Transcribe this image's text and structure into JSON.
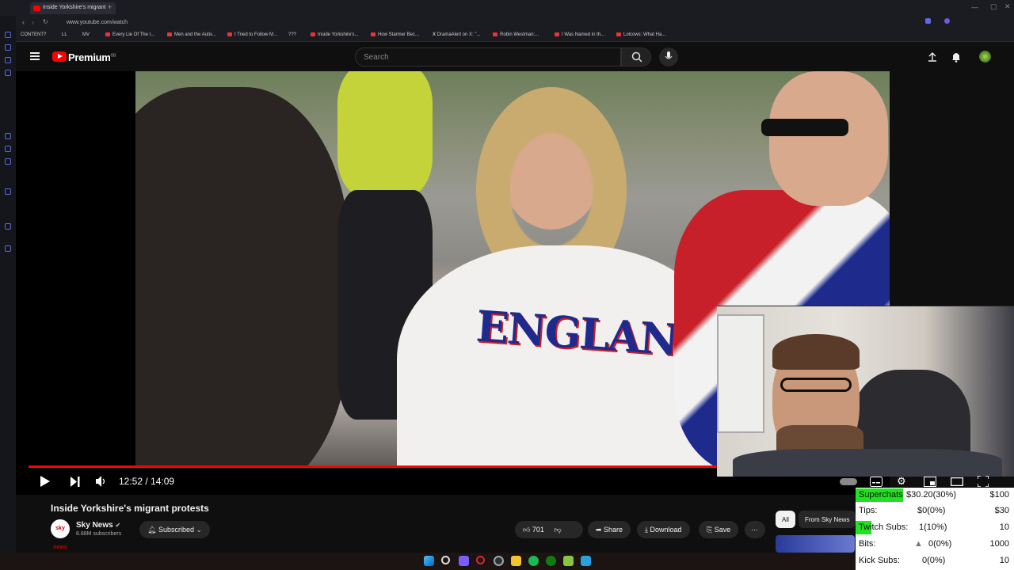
{
  "browser": {
    "tab_title": "Inside Yorkshire's migrant",
    "url": "www.youtube.com/watch",
    "bookmarks": [
      "CONTENT?",
      "LL",
      "MV",
      "Every Lie Of The I...",
      "Men and the Autis...",
      "I Tried to Follow M...",
      "???",
      "Inside Yorkshire's...",
      "How Starmer Bec...",
      "DramaAlert on X: \"...",
      "Robin Westman:...",
      "I Was Named in th...",
      "Lolcows: What Ha..."
    ]
  },
  "header": {
    "brand": "Premium",
    "region": "GB",
    "search_placeholder": "Search"
  },
  "player": {
    "current_time": "12:52",
    "duration": "14:09",
    "time_text": "12:52 / 14:09",
    "progress_fraction": 0.909,
    "overlay_text": "ENGLAND"
  },
  "video": {
    "title": "Inside Yorkshire's migrant protests",
    "channel": "Sky News",
    "channel_avatar_text": "sky news",
    "subscribers": "8.88M subscribers",
    "subscribe_label": "Subscribed",
    "likes": "701",
    "share_label": "Share",
    "download_label": "Download",
    "save_label": "Save"
  },
  "chips": [
    "All",
    "From Sky News"
  ],
  "donation_stats": [
    {
      "label": "Superchats",
      "value": "$30.20(30%)",
      "goal": "$100",
      "highlight": 0.3
    },
    {
      "label": "Tips:",
      "value": "$0(0%)",
      "goal": "$30",
      "highlight": 0
    },
    {
      "label": "Twitch Subs:",
      "value": "1(10%)",
      "goal": "10",
      "highlight": 0.1
    },
    {
      "label": "Bits:",
      "value": "0(0%)",
      "goal": "1000",
      "highlight": 0
    },
    {
      "label": "Kick Subs:",
      "value": "0(0%)",
      "goal": "10",
      "highlight": 0
    }
  ],
  "colors": {
    "accent": "#ff0000",
    "highlight": "#22e022"
  }
}
